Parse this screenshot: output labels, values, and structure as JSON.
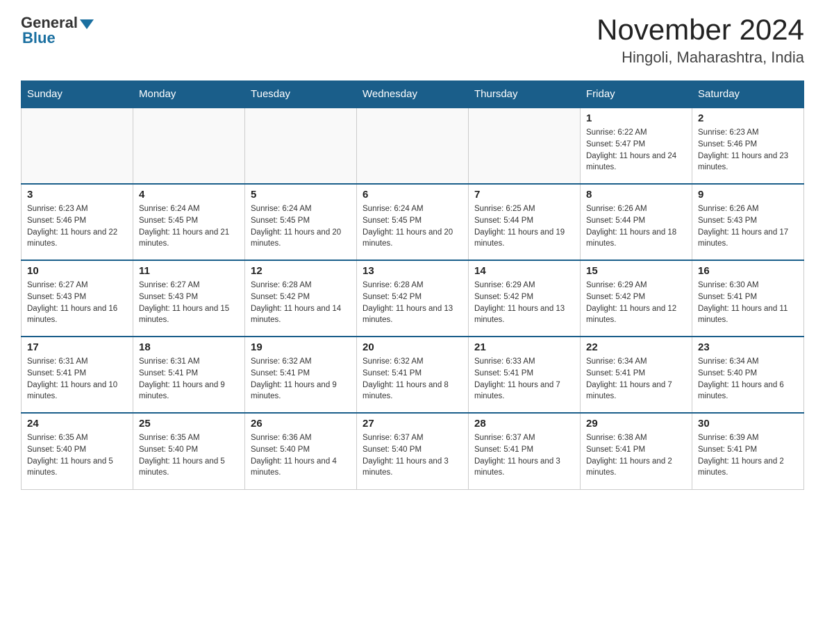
{
  "header": {
    "logo_general": "General",
    "logo_blue": "Blue",
    "month_year": "November 2024",
    "location": "Hingoli, Maharashtra, India"
  },
  "weekdays": [
    "Sunday",
    "Monday",
    "Tuesday",
    "Wednesday",
    "Thursday",
    "Friday",
    "Saturday"
  ],
  "weeks": [
    [
      {
        "day": "",
        "info": ""
      },
      {
        "day": "",
        "info": ""
      },
      {
        "day": "",
        "info": ""
      },
      {
        "day": "",
        "info": ""
      },
      {
        "day": "",
        "info": ""
      },
      {
        "day": "1",
        "info": "Sunrise: 6:22 AM\nSunset: 5:47 PM\nDaylight: 11 hours and 24 minutes."
      },
      {
        "day": "2",
        "info": "Sunrise: 6:23 AM\nSunset: 5:46 PM\nDaylight: 11 hours and 23 minutes."
      }
    ],
    [
      {
        "day": "3",
        "info": "Sunrise: 6:23 AM\nSunset: 5:46 PM\nDaylight: 11 hours and 22 minutes."
      },
      {
        "day": "4",
        "info": "Sunrise: 6:24 AM\nSunset: 5:45 PM\nDaylight: 11 hours and 21 minutes."
      },
      {
        "day": "5",
        "info": "Sunrise: 6:24 AM\nSunset: 5:45 PM\nDaylight: 11 hours and 20 minutes."
      },
      {
        "day": "6",
        "info": "Sunrise: 6:24 AM\nSunset: 5:45 PM\nDaylight: 11 hours and 20 minutes."
      },
      {
        "day": "7",
        "info": "Sunrise: 6:25 AM\nSunset: 5:44 PM\nDaylight: 11 hours and 19 minutes."
      },
      {
        "day": "8",
        "info": "Sunrise: 6:26 AM\nSunset: 5:44 PM\nDaylight: 11 hours and 18 minutes."
      },
      {
        "day": "9",
        "info": "Sunrise: 6:26 AM\nSunset: 5:43 PM\nDaylight: 11 hours and 17 minutes."
      }
    ],
    [
      {
        "day": "10",
        "info": "Sunrise: 6:27 AM\nSunset: 5:43 PM\nDaylight: 11 hours and 16 minutes."
      },
      {
        "day": "11",
        "info": "Sunrise: 6:27 AM\nSunset: 5:43 PM\nDaylight: 11 hours and 15 minutes."
      },
      {
        "day": "12",
        "info": "Sunrise: 6:28 AM\nSunset: 5:42 PM\nDaylight: 11 hours and 14 minutes."
      },
      {
        "day": "13",
        "info": "Sunrise: 6:28 AM\nSunset: 5:42 PM\nDaylight: 11 hours and 13 minutes."
      },
      {
        "day": "14",
        "info": "Sunrise: 6:29 AM\nSunset: 5:42 PM\nDaylight: 11 hours and 13 minutes."
      },
      {
        "day": "15",
        "info": "Sunrise: 6:29 AM\nSunset: 5:42 PM\nDaylight: 11 hours and 12 minutes."
      },
      {
        "day": "16",
        "info": "Sunrise: 6:30 AM\nSunset: 5:41 PM\nDaylight: 11 hours and 11 minutes."
      }
    ],
    [
      {
        "day": "17",
        "info": "Sunrise: 6:31 AM\nSunset: 5:41 PM\nDaylight: 11 hours and 10 minutes."
      },
      {
        "day": "18",
        "info": "Sunrise: 6:31 AM\nSunset: 5:41 PM\nDaylight: 11 hours and 9 minutes."
      },
      {
        "day": "19",
        "info": "Sunrise: 6:32 AM\nSunset: 5:41 PM\nDaylight: 11 hours and 9 minutes."
      },
      {
        "day": "20",
        "info": "Sunrise: 6:32 AM\nSunset: 5:41 PM\nDaylight: 11 hours and 8 minutes."
      },
      {
        "day": "21",
        "info": "Sunrise: 6:33 AM\nSunset: 5:41 PM\nDaylight: 11 hours and 7 minutes."
      },
      {
        "day": "22",
        "info": "Sunrise: 6:34 AM\nSunset: 5:41 PM\nDaylight: 11 hours and 7 minutes."
      },
      {
        "day": "23",
        "info": "Sunrise: 6:34 AM\nSunset: 5:40 PM\nDaylight: 11 hours and 6 minutes."
      }
    ],
    [
      {
        "day": "24",
        "info": "Sunrise: 6:35 AM\nSunset: 5:40 PM\nDaylight: 11 hours and 5 minutes."
      },
      {
        "day": "25",
        "info": "Sunrise: 6:35 AM\nSunset: 5:40 PM\nDaylight: 11 hours and 5 minutes."
      },
      {
        "day": "26",
        "info": "Sunrise: 6:36 AM\nSunset: 5:40 PM\nDaylight: 11 hours and 4 minutes."
      },
      {
        "day": "27",
        "info": "Sunrise: 6:37 AM\nSunset: 5:40 PM\nDaylight: 11 hours and 3 minutes."
      },
      {
        "day": "28",
        "info": "Sunrise: 6:37 AM\nSunset: 5:41 PM\nDaylight: 11 hours and 3 minutes."
      },
      {
        "day": "29",
        "info": "Sunrise: 6:38 AM\nSunset: 5:41 PM\nDaylight: 11 hours and 2 minutes."
      },
      {
        "day": "30",
        "info": "Sunrise: 6:39 AM\nSunset: 5:41 PM\nDaylight: 11 hours and 2 minutes."
      }
    ]
  ]
}
